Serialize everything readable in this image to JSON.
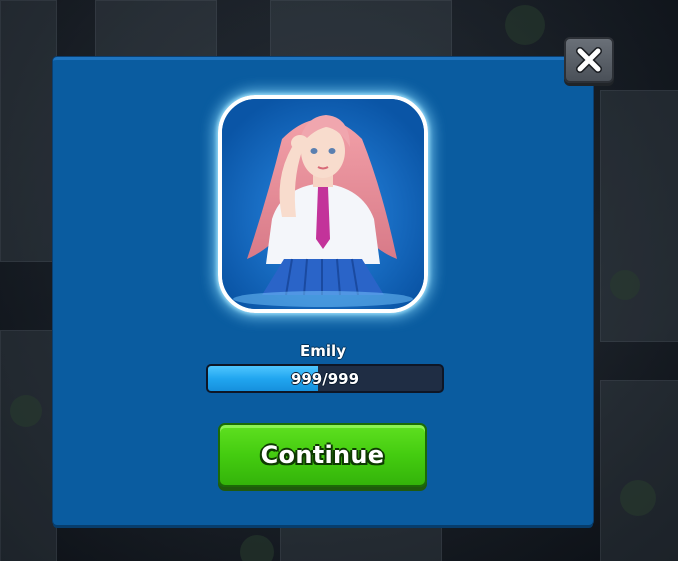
{
  "dialog": {
    "character_name": "Emily",
    "hp_text": "999/999",
    "hp_fill_fraction": 0.47,
    "continue_label": "Continue",
    "close_icon": "close-icon"
  },
  "colors": {
    "panel": "#0a5ca0",
    "continue_button": "#44cc10",
    "progress_fill": "#21a6f0",
    "progress_track": "#1f2d44",
    "close_button": "#5a6068"
  }
}
